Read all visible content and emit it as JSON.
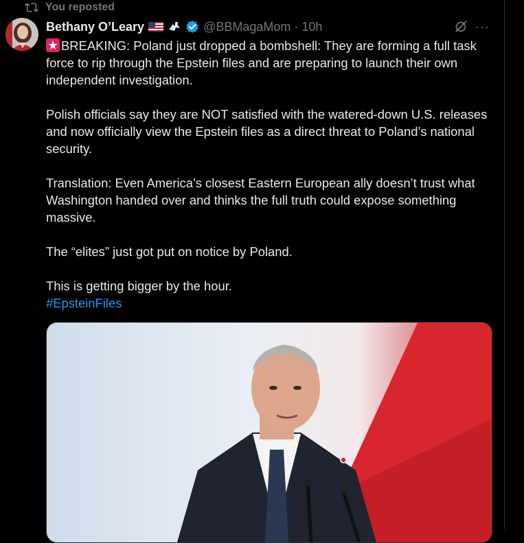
{
  "repost": {
    "label": "You reposted"
  },
  "post": {
    "author_name": "Bethany O’Leary",
    "handle": "@BBMagaMom",
    "separator": "·",
    "time": "10h",
    "more_label": "···",
    "paragraphs": [
      "BREAKING: Poland just dropped a bombshell: They are forming a full task force to rip through the Epstein files and are preparing to launch their own independent investigation.",
      "Polish officials say they are NOT satisfied with the watered-down U.S. releases and now officially view the Epstein files as a direct threat to Poland’s national security.",
      "Translation: Even America’s closest Eastern European ally doesn’t trust what Washington handed over and thinks the full truth could expose something massive.",
      "The “elites” just got put on notice by Poland.",
      "This is getting bigger by the hour."
    ],
    "hashtag": "#EpsteinFiles"
  },
  "icons": {
    "repost": "repost-icon",
    "flag": "us-flag-icon",
    "eagle": "eagle-icon",
    "verified": "verified-badge-icon",
    "grok": "grok-icon",
    "more": "more-icon",
    "siren": "siren-icon"
  },
  "colors": {
    "background": "#000000",
    "text": "#e7e9ea",
    "muted": "#71767b",
    "link": "#1d9bf0",
    "verified": "#1d9bf0"
  }
}
